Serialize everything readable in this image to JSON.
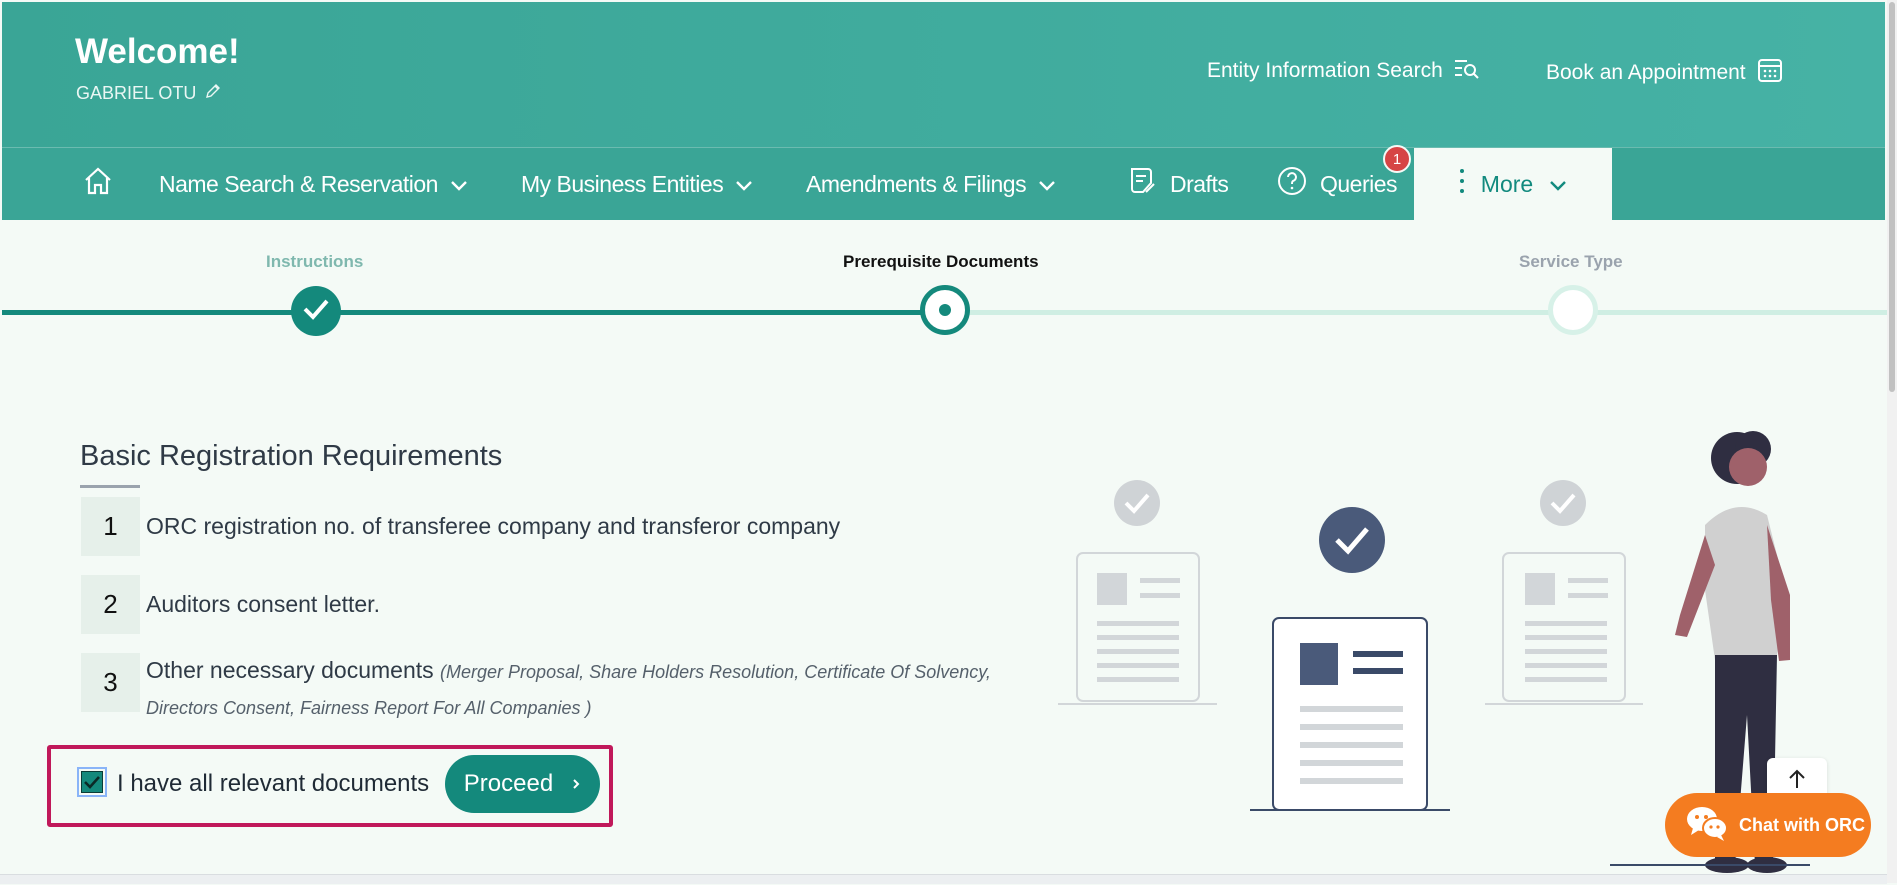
{
  "header": {
    "welcome": "Welcome!",
    "username": "GABRIEL OTU",
    "entity_search": "Entity Information Search",
    "book_appointment": "Book an Appointment"
  },
  "nav": {
    "name_search": "Name Search & Reservation",
    "business_entities": "My Business Entities",
    "amendments": "Amendments & Filings",
    "drafts": "Drafts",
    "queries": "Queries",
    "queries_badge": "1",
    "more": "More"
  },
  "stepper": {
    "steps": [
      {
        "label": "Instructions",
        "state": "completed"
      },
      {
        "label": "Prerequisite Documents",
        "state": "active"
      },
      {
        "label": "Service Type",
        "state": "pending"
      }
    ]
  },
  "requirements": {
    "title": "Basic Registration Requirements",
    "items": [
      {
        "num": "1",
        "text": "ORC registration no. of transferee company and transferor company"
      },
      {
        "num": "2",
        "text": "Auditors consent letter."
      },
      {
        "num": "3",
        "text": "Other necessary documents",
        "note": "(Merger Proposal, Share Holders Resolution, Certificate Of Solvency,",
        "note2": "Directors Consent, Fairness Report For All Companies )"
      }
    ]
  },
  "confirm": {
    "checkbox_label": "I have all relevant documents",
    "checked": true,
    "proceed": "Proceed"
  },
  "chat": {
    "label": "Chat with ORC"
  },
  "colors": {
    "primary": "#14897c",
    "header": "#3aa596",
    "badge": "#d64545",
    "highlight": "#c0185a",
    "chat": "#f47c20"
  }
}
